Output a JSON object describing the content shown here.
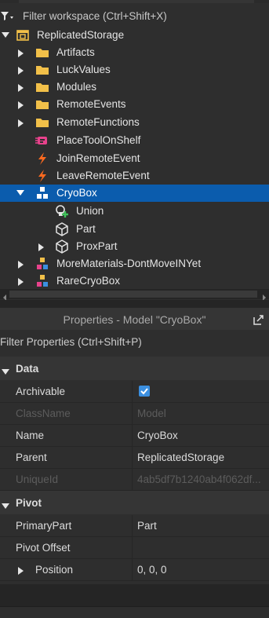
{
  "explorer": {
    "filter_placeholder": "Filter workspace (Ctrl+Shift+X)",
    "items": [
      {
        "label": "ReplicatedStorage",
        "icon": "replicated-storage-icon",
        "expanded": true
      },
      {
        "label": "Artifacts",
        "icon": "folder-icon",
        "expanded": false
      },
      {
        "label": "LuckValues",
        "icon": "folder-icon",
        "expanded": false
      },
      {
        "label": "Modules",
        "icon": "folder-icon",
        "expanded": false
      },
      {
        "label": "RemoteEvents",
        "icon": "folder-icon",
        "expanded": false
      },
      {
        "label": "RemoteFunctions",
        "icon": "folder-icon",
        "expanded": false
      },
      {
        "label": "PlaceToolOnShelf",
        "icon": "remote-function-icon"
      },
      {
        "label": "JoinRemoteEvent",
        "icon": "remote-event-icon"
      },
      {
        "label": "LeaveRemoteEvent",
        "icon": "remote-event-icon"
      },
      {
        "label": "CryoBox",
        "icon": "model-icon",
        "expanded": true,
        "selected": true
      },
      {
        "label": "Union",
        "icon": "union-icon"
      },
      {
        "label": "Part",
        "icon": "part-icon"
      },
      {
        "label": "ProxPart",
        "icon": "part-icon",
        "expanded": false
      },
      {
        "label": "MoreMaterials-DontMoveINYet",
        "icon": "model-colored-icon",
        "expanded": false
      },
      {
        "label": "RareCryoBox",
        "icon": "model-colored-icon",
        "expanded": false
      }
    ]
  },
  "properties": {
    "title": "Properties - Model \"CryoBox\"",
    "filter_placeholder": "Filter Properties (Ctrl+Shift+P)",
    "categories": [
      {
        "name": "Data",
        "rows": [
          {
            "name": "Archivable",
            "value": "",
            "checked": true
          },
          {
            "name": "ClassName",
            "value": "Model",
            "disabled": true
          },
          {
            "name": "Name",
            "value": "CryoBox"
          },
          {
            "name": "Parent",
            "value": "ReplicatedStorage"
          },
          {
            "name": "UniqueId",
            "value": "4ab5df7b1240ab4f062df...",
            "disabled": true
          }
        ]
      },
      {
        "name": "Pivot",
        "rows": [
          {
            "name": "PrimaryPart",
            "value": "Part"
          },
          {
            "name": "Pivot Offset",
            "value": ""
          },
          {
            "name": "Position",
            "value": "0, 0, 0"
          }
        ]
      }
    ]
  },
  "colors": {
    "selection": "#0b5cad",
    "folder": "#f2c049",
    "checkbox": "#3b8fe0",
    "remote_event": "#ff6a1f",
    "remote_function": "#e8428c"
  }
}
